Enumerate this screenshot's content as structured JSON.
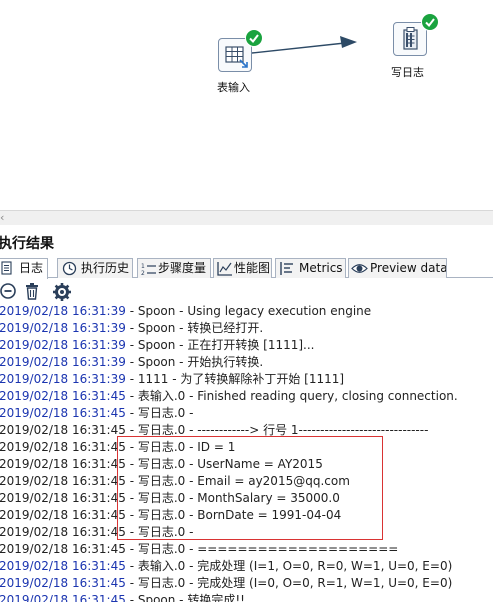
{
  "canvas": {
    "steps": [
      {
        "name": "table-input-step",
        "label": "表输入",
        "status": "ok",
        "icon": "table-input-icon"
      },
      {
        "name": "write-log-step",
        "label": "写日志",
        "status": "ok",
        "icon": "write-log-icon"
      }
    ]
  },
  "results": {
    "title": "执行结果",
    "tabs": [
      {
        "label": "日志",
        "icon": "log-icon",
        "active": true
      },
      {
        "label": "执行历史",
        "icon": "history-icon"
      },
      {
        "label": "步骤度量",
        "icon": "step-metrics-icon"
      },
      {
        "label": "性能图",
        "icon": "performance-chart-icon"
      },
      {
        "label": "Metrics",
        "icon": "metrics-icon"
      },
      {
        "label": "Preview data",
        "icon": "preview-eye-icon"
      }
    ],
    "toolbar": [
      {
        "name": "clear-log-button",
        "icon": "clear-icon"
      },
      {
        "name": "delete-log-button",
        "icon": "trash-icon"
      },
      {
        "name": "log-settings-button",
        "icon": "gear-icon"
      }
    ]
  },
  "log": [
    {
      "time": "2019/02/18 16:31:39",
      "message": " - Spoon - Using legacy execution engine",
      "blue": true
    },
    {
      "time": "2019/02/18 16:31:39",
      "message": " - Spoon - 转换已经打开.",
      "blue": true
    },
    {
      "time": "2019/02/18 16:31:39",
      "message": " - Spoon - 正在打开转换 [1111]...",
      "blue": true
    },
    {
      "time": "2019/02/18 16:31:39",
      "message": " - Spoon - 开始执行转换.",
      "blue": true
    },
    {
      "time": "2019/02/18 16:31:39",
      "message": " - 1111 - 为了转换解除补丁开始  [1111]",
      "blue": true
    },
    {
      "time": "2019/02/18 16:31:45",
      "message": " - 表输入.0 - Finished reading query, closing connection.",
      "blue": true
    },
    {
      "time": "2019/02/18 16:31:45",
      "message": " - 写日志.0 -",
      "blue": true
    },
    {
      "time": "2019/02/18 16:31:45",
      "message": " - 写日志.0 - ------------> 行号 1------------------------------",
      "blue": false
    },
    {
      "time": "2019/02/18 16:31:45",
      "message": " - 写日志.0 - ID = 1",
      "blue": false
    },
    {
      "time": "2019/02/18 16:31:45",
      "message": " - 写日志.0 - UserName = AY2015",
      "blue": false
    },
    {
      "time": "2019/02/18 16:31:45",
      "message": " - 写日志.0 - Email = ay2015@qq.com",
      "blue": false
    },
    {
      "time": "2019/02/18 16:31:45",
      "message": " - 写日志.0 - MonthSalary = 35000.0",
      "blue": false
    },
    {
      "time": "2019/02/18 16:31:45",
      "message": " - 写日志.0 - BornDate = 1991-04-04",
      "blue": false
    },
    {
      "time": "2019/02/18 16:31:45",
      "message": " - 写日志.0 -",
      "blue": false
    },
    {
      "time": "2019/02/18 16:31:45",
      "message": " - 写日志.0 - ====================",
      "blue": false
    },
    {
      "time": "2019/02/18 16:31:45",
      "message": " - 表输入.0 - 完成处理 (I=1, O=0, R=0, W=1, U=0, E=0)",
      "blue": true
    },
    {
      "time": "2019/02/18 16:31:45",
      "message": " - 写日志.0 - 完成处理 (I=0, O=0, R=1, W=1, U=0, E=0)",
      "blue": true
    },
    {
      "time": "2019/02/18 16:31:45",
      "message": " - Spoon - 转换完成!!",
      "blue": true
    }
  ],
  "colors": {
    "timestamp_blue": "#1b35b0",
    "ok_green": "#1aa33f",
    "highlight_red": "#d93333"
  }
}
